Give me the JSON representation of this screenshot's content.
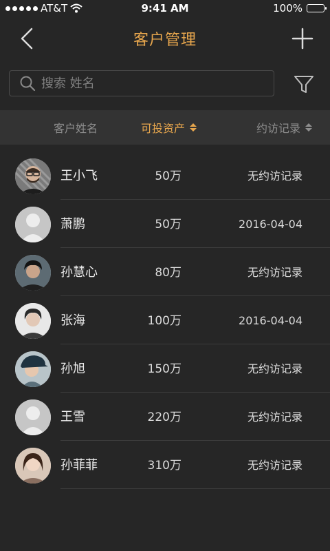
{
  "status_bar": {
    "carrier": "AT&T",
    "time": "9:41 AM",
    "battery": "100%"
  },
  "nav": {
    "title": "客户管理",
    "back_icon": "chevron-left-icon",
    "add_icon": "plus-icon"
  },
  "search": {
    "placeholder": "搜索 姓名",
    "value": "",
    "icon": "search-icon"
  },
  "filter": {
    "icon": "filter-icon"
  },
  "table_header": {
    "name": "客户姓名",
    "assets": "可投资产",
    "visit": "约访记录",
    "active_color": "#e7a64d"
  },
  "clients": [
    {
      "name": "王小飞",
      "assets": "50万",
      "visit": "无约访记录",
      "avatar": "photo"
    },
    {
      "name": "萧鹏",
      "assets": "50万",
      "visit": "2016-04-04",
      "avatar": "placeholder"
    },
    {
      "name": "孙慧心",
      "assets": "80万",
      "visit": "无约访记录",
      "avatar": "photo"
    },
    {
      "name": "张海",
      "assets": "100万",
      "visit": "2016-04-04",
      "avatar": "photo"
    },
    {
      "name": "孙旭",
      "assets": "150万",
      "visit": "无约访记录",
      "avatar": "photo"
    },
    {
      "name": "王雪",
      "assets": "220万",
      "visit": "无约访记录",
      "avatar": "placeholder"
    },
    {
      "name": "孙菲菲",
      "assets": "310万",
      "visit": "无约访记录",
      "avatar": "photo"
    }
  ],
  "colors": {
    "background": "#262626",
    "header_band": "#333333",
    "accent": "#e7a64d"
  }
}
